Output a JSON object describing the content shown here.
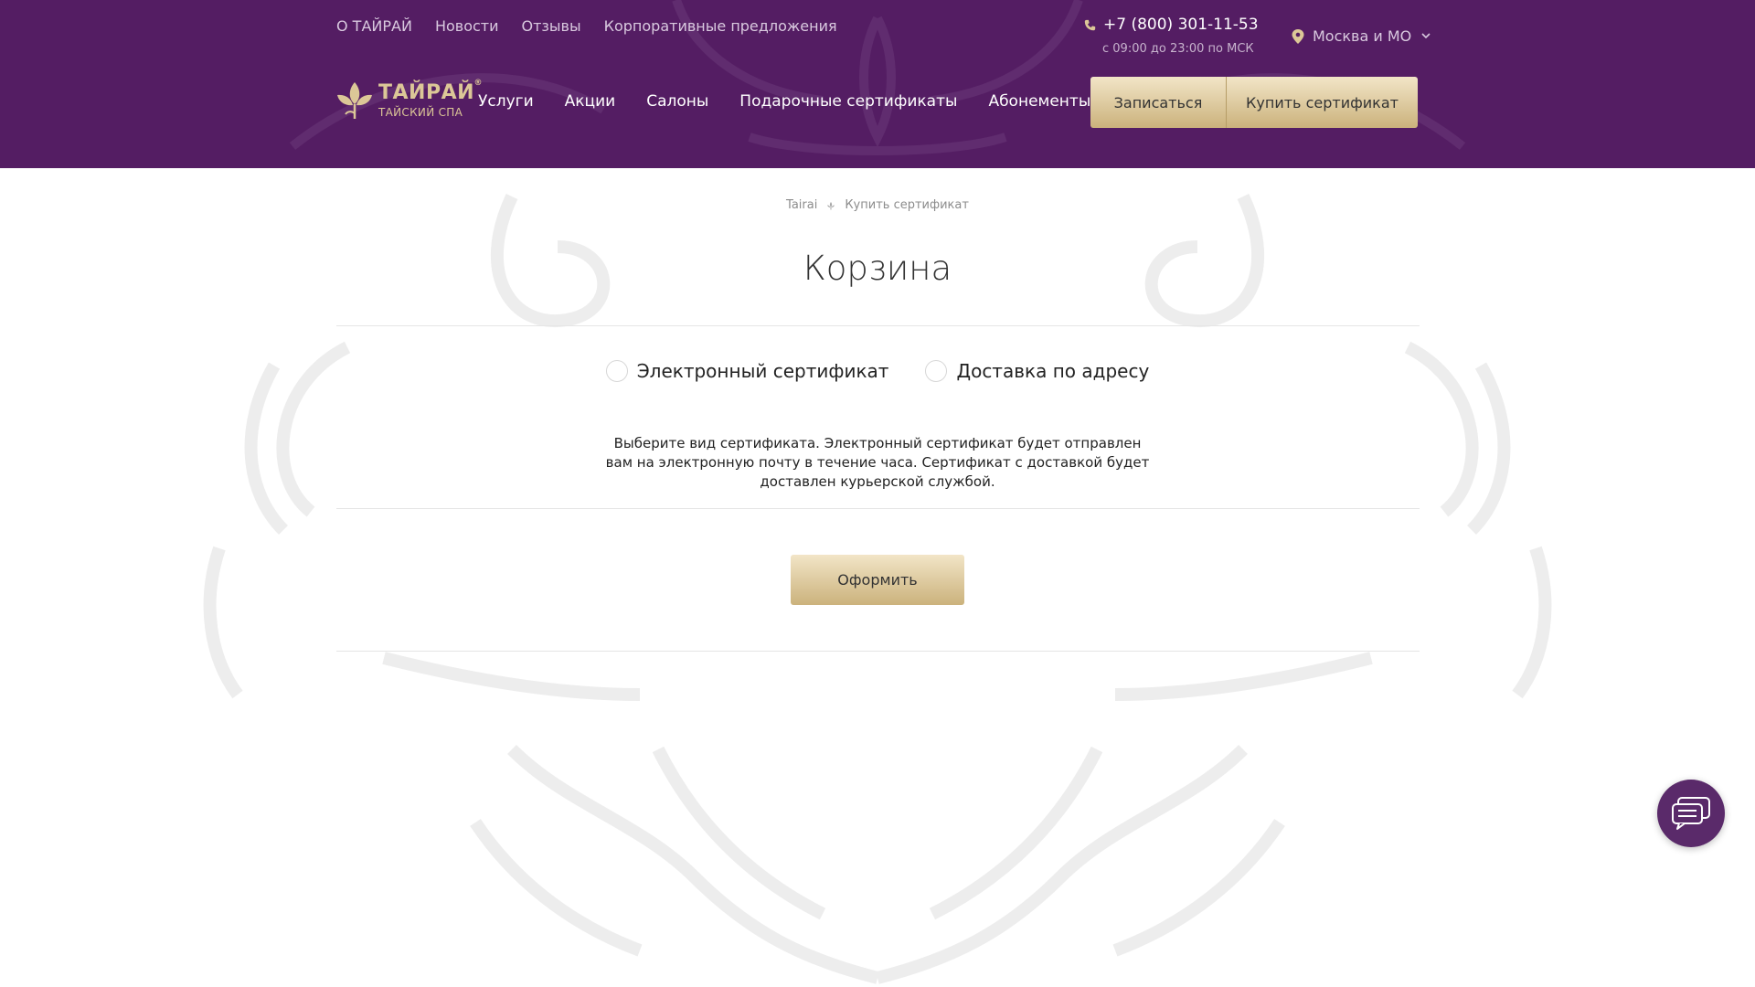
{
  "colors": {
    "header_bg": "#541d63",
    "gold_light": "#f2e5c7",
    "gold_dark": "#cbb27c",
    "logo_gold": "#dcc797",
    "chat_bg": "#5a2a6a"
  },
  "top_nav": {
    "items": [
      {
        "label": "О ТАЙРАЙ"
      },
      {
        "label": "Новости"
      },
      {
        "label": "Отзывы"
      },
      {
        "label": "Корпоративные предложения"
      }
    ]
  },
  "contact": {
    "phone_icon": "phone-icon",
    "phone": "+7 (800) 301-11-53",
    "hours": "с 09:00 до 23:00 по МСК"
  },
  "city": {
    "icon": "location-pin-icon",
    "selected": "Москва и МО"
  },
  "logo": {
    "title": "ТАЙРАЙ",
    "registered": "®",
    "subtitle": "ТАЙСКИЙ СПА"
  },
  "main_nav": {
    "items": [
      {
        "label": "Услуги"
      },
      {
        "label": "Акции"
      },
      {
        "label": "Салоны"
      },
      {
        "label": "Подарочные сертификаты"
      },
      {
        "label": "Абонементы"
      }
    ]
  },
  "header_buttons": {
    "signup": "Записаться",
    "buy_certificate": "Купить сертификат"
  },
  "breadcrumb": {
    "home": "Tairai",
    "current": "Купить сертификат"
  },
  "page": {
    "title": "Корзина"
  },
  "certificate_type": {
    "options": [
      {
        "label": "Электронный сертификат",
        "selected": false
      },
      {
        "label": "Доставка по адресу",
        "selected": false
      }
    ],
    "description": "Выберите вид сертификата. Электронный сертификат будет отправлен вам на электронную почту в течение часа. Сертификат с доставкой будет доставлен курьерской службой."
  },
  "checkout": {
    "label": "Оформить"
  },
  "chat": {
    "icon": "chat-icon"
  }
}
